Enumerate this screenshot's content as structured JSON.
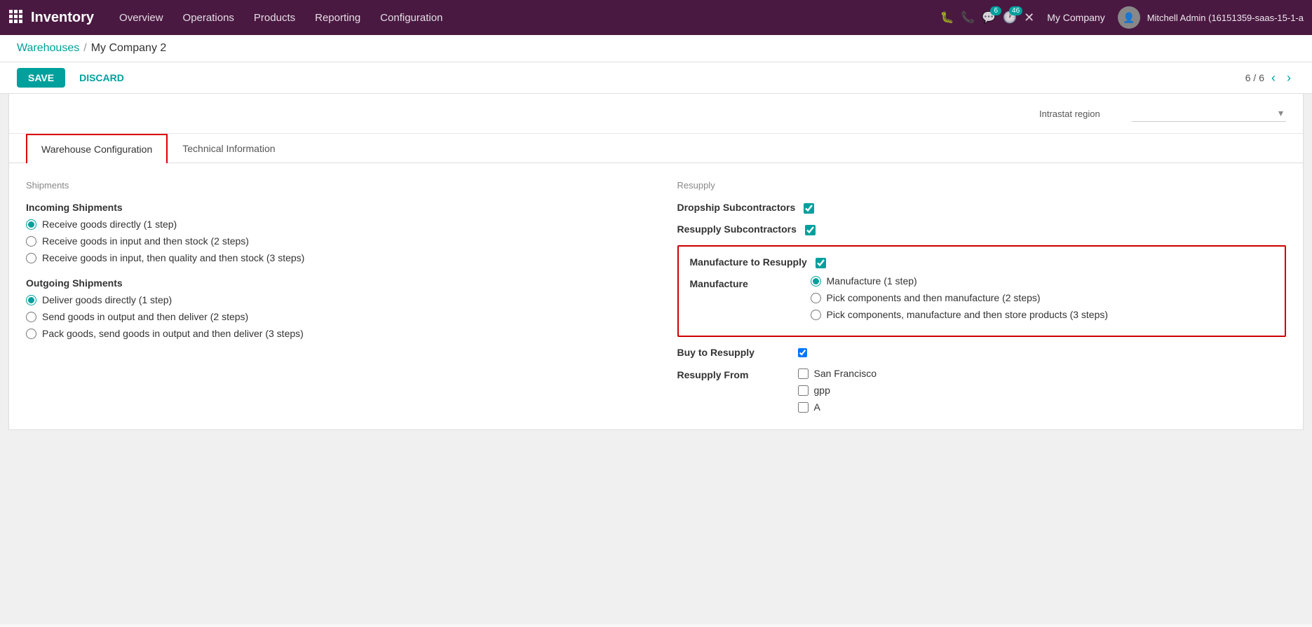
{
  "topnav": {
    "app_grid_icon": "⊞",
    "app_name": "Inventory",
    "nav_items": [
      "Overview",
      "Operations",
      "Products",
      "Reporting",
      "Configuration"
    ],
    "chat_badge": "6",
    "activity_badge": "46",
    "company": "My Company",
    "user": "Mitchell Admin (16151359-saas-15-1-a"
  },
  "breadcrumb": {
    "parent": "Warehouses",
    "separator": "/",
    "current": "My Company 2"
  },
  "actions": {
    "save": "SAVE",
    "discard": "DISCARD",
    "pager": "6 / 6"
  },
  "intrastat": {
    "label": "Intrastat region"
  },
  "tabs": [
    {
      "id": "warehouse-configuration",
      "label": "Warehouse Configuration",
      "active": true
    },
    {
      "id": "technical-information",
      "label": "Technical Information",
      "active": false
    }
  ],
  "shipments": {
    "section_title": "Shipments",
    "incoming": {
      "label": "Incoming Shipments",
      "options": [
        {
          "label": "Receive goods directly (1 step)",
          "selected": true
        },
        {
          "label": "Receive goods in input and then stock (2 steps)",
          "selected": false
        },
        {
          "label": "Receive goods in input, then quality and then stock (3 steps)",
          "selected": false
        }
      ]
    },
    "outgoing": {
      "label": "Outgoing Shipments",
      "options": [
        {
          "label": "Deliver goods directly (1 step)",
          "selected": true
        },
        {
          "label": "Send goods in output and then deliver (2 steps)",
          "selected": false
        },
        {
          "label": "Pack goods, send goods in output and then deliver (3 steps)",
          "selected": false
        }
      ]
    }
  },
  "resupply": {
    "section_title": "Resupply",
    "dropship_subcontractors": {
      "label": "Dropship Subcontractors",
      "checked": true
    },
    "resupply_subcontractors": {
      "label": "Resupply Subcontractors",
      "checked": true
    },
    "manufacture_to_resupply": {
      "label": "Manufacture to Resupply",
      "checked": true
    },
    "manufacture": {
      "label": "Manufacture",
      "options": [
        {
          "label": "Manufacture (1 step)",
          "selected": true
        },
        {
          "label": "Pick components and then manufacture (2 steps)",
          "selected": false
        },
        {
          "label": "Pick components, manufacture and then store products (3 steps)",
          "selected": false
        }
      ]
    },
    "buy_to_resupply": {
      "label": "Buy to Resupply",
      "checked": true
    },
    "resupply_from": {
      "label": "Resupply From",
      "options": [
        {
          "label": "San Francisco",
          "checked": false
        },
        {
          "label": "gpp",
          "checked": false
        },
        {
          "label": "A",
          "checked": false
        }
      ]
    }
  }
}
